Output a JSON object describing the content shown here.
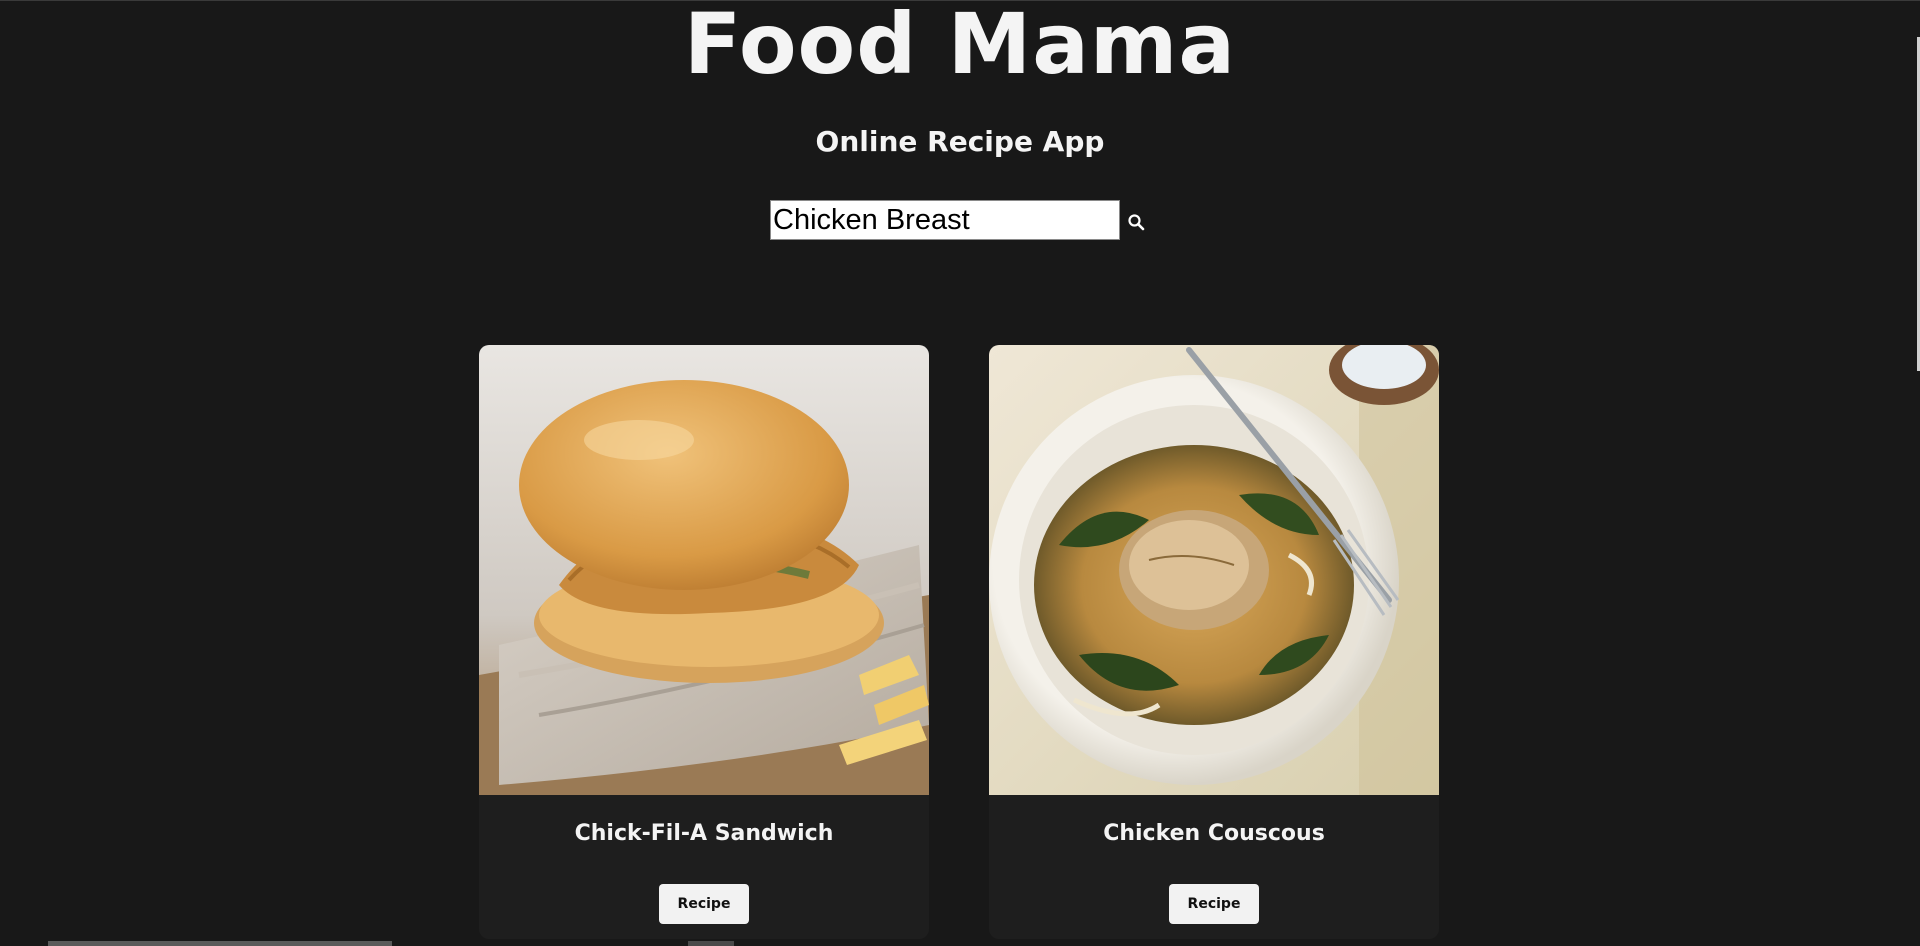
{
  "header": {
    "title": "Food Mama",
    "subtitle": "Online Recipe App"
  },
  "search": {
    "value": "Chicken Breast",
    "icon": "search-icon"
  },
  "recipes": [
    {
      "name": "Chick-Fil-A Sandwich",
      "button_label": "Recipe",
      "image": "chicken-sandwich-photo"
    },
    {
      "name": "Chicken Couscous",
      "button_label": "Recipe",
      "image": "chicken-couscous-photo"
    }
  ],
  "colors": {
    "background": "#181818",
    "card": "#1e1e1e",
    "text": "#f4f4f4",
    "button": "#f2f2f2"
  }
}
